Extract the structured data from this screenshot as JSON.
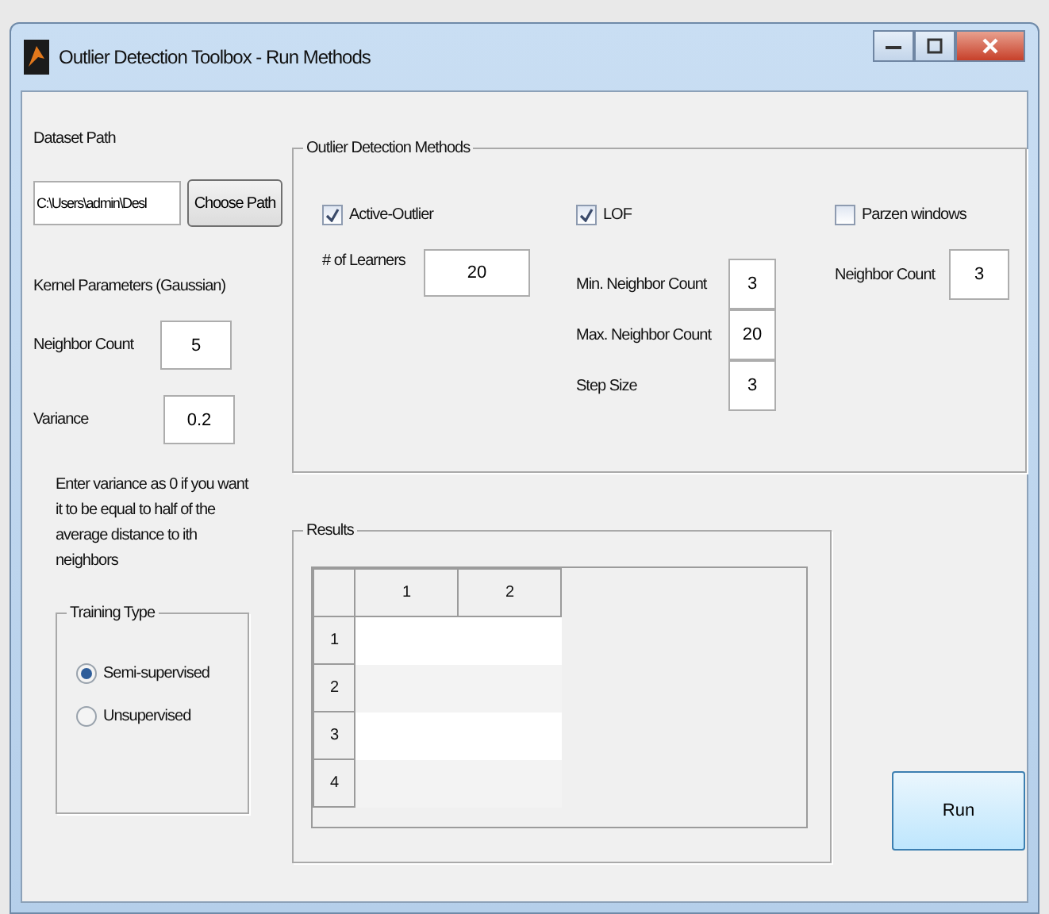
{
  "window": {
    "title": "Outlier Detection Toolbox - Run Methods"
  },
  "dataset": {
    "label": "Dataset Path",
    "value": "C:\\Users\\admin\\Desl",
    "button": "Choose Path"
  },
  "kernel": {
    "heading": "Kernel Parameters (Gaussian)",
    "fields": [
      {
        "label": "Neighbor Count",
        "value": "5"
      },
      {
        "label": "Variance",
        "value": "0.2"
      }
    ],
    "note": "Enter variance as 0 if you want it to be equal to half of the average distance to ith neighbors"
  },
  "training_type": {
    "title": "Training Type",
    "options": [
      {
        "label": "Semi-supervised",
        "selected": true
      },
      {
        "label": "Unsupervised",
        "selected": false
      }
    ]
  },
  "methods": {
    "title": "Outlier Detection Methods",
    "columns": [
      {
        "label": "Active-Outlier",
        "checked": true,
        "fields": [
          {
            "label": "# of Learners",
            "value": "20"
          }
        ]
      },
      {
        "label": "LOF",
        "checked": true,
        "fields": [
          {
            "label": "Min. Neighbor Count",
            "value": "3"
          },
          {
            "label": "Max. Neighbor Count",
            "value": "20"
          },
          {
            "label": "Step Size",
            "value": "3"
          }
        ]
      },
      {
        "label": "Parzen windows",
        "checked": false,
        "fields": [
          {
            "label": "Neighbor Count",
            "value": "3"
          }
        ]
      }
    ]
  },
  "results": {
    "title": "Results",
    "columns": [
      "1",
      "2"
    ],
    "rows": [
      "1",
      "2",
      "3",
      "4"
    ]
  },
  "run_button": "Run"
}
